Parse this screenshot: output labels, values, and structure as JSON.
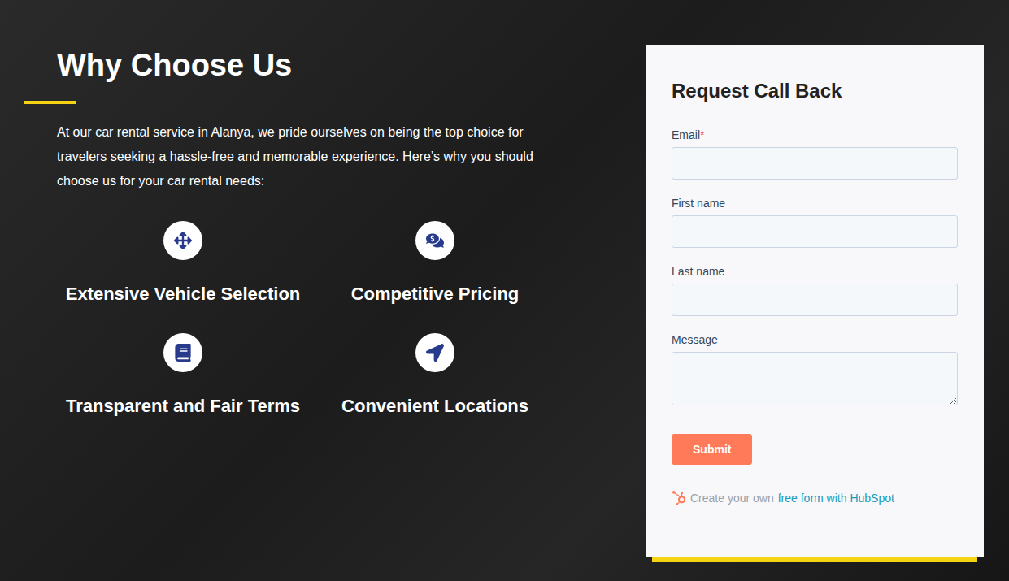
{
  "section": {
    "title": "Why Choose Us",
    "intro": "At our car rental service in Alanya, we pride ourselves on being the top choice for travelers seeking a hassle-free and memorable experience. Here’s why you should choose us for your car rental needs:"
  },
  "features": [
    {
      "title": "Extensive Vehicle Selection"
    },
    {
      "title": "Competitive Pricing"
    },
    {
      "title": "Transparent and Fair Terms"
    },
    {
      "title": "Convenient Locations"
    }
  ],
  "form": {
    "title": "Request Call Back",
    "required_mark": "*",
    "fields": [
      {
        "label": "Email",
        "required": true,
        "kind": "input"
      },
      {
        "label": "First name",
        "required": false,
        "kind": "input"
      },
      {
        "label": "Last name",
        "required": false,
        "kind": "input"
      },
      {
        "label": "Message",
        "required": false,
        "kind": "textarea"
      }
    ],
    "submit": "Submit",
    "footer": {
      "text": "Create your own",
      "link": "free form with HubSpot"
    }
  }
}
